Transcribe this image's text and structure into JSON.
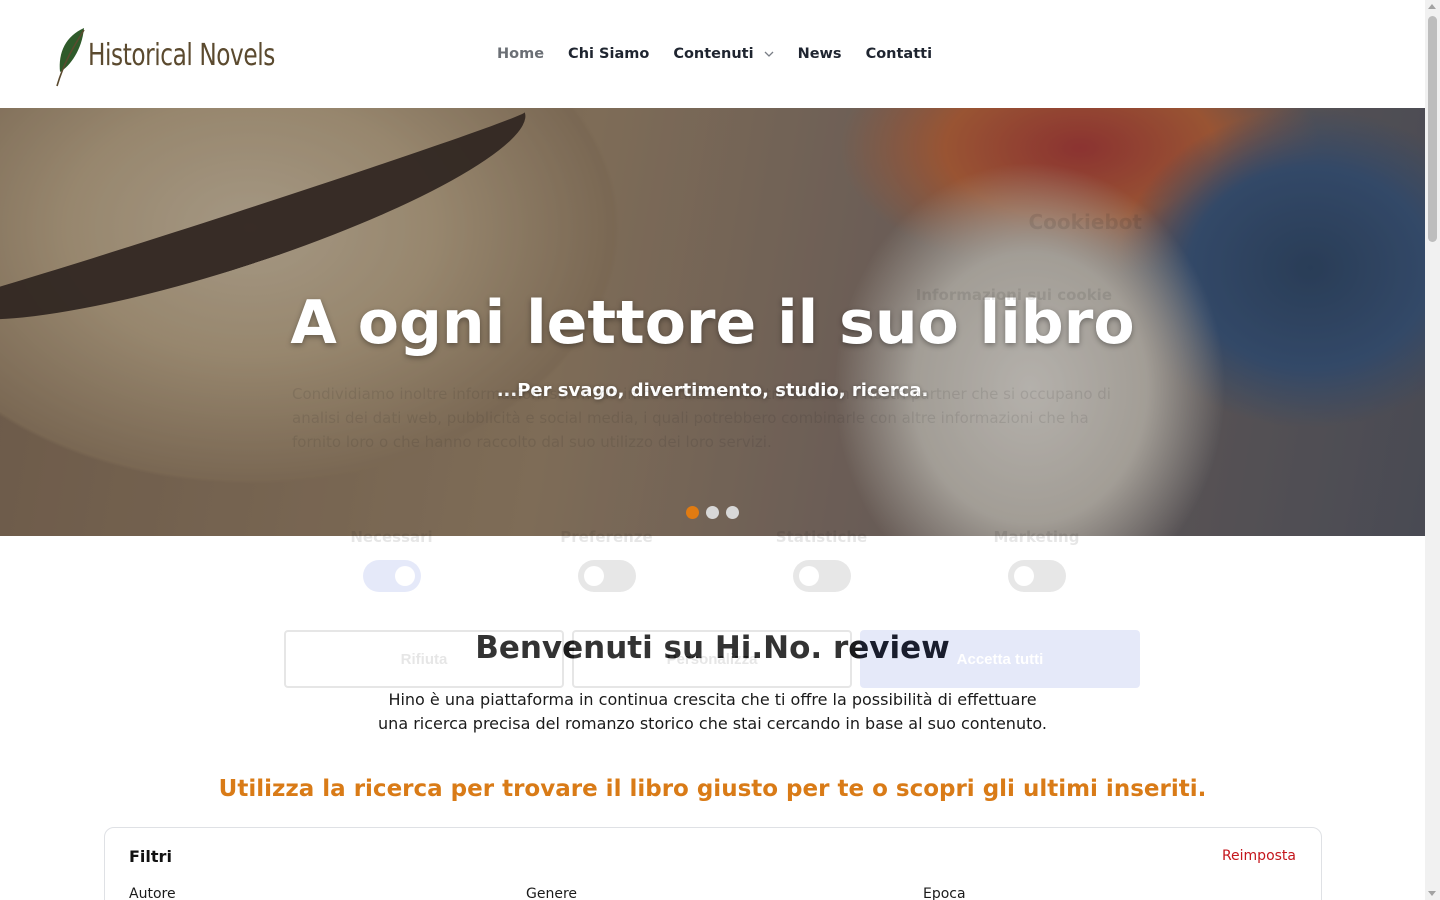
{
  "header": {
    "logo_text": "Historical Novels",
    "nav": [
      {
        "label": "Home",
        "active": true
      },
      {
        "label": "Chi Siamo"
      },
      {
        "label": "Contenuti",
        "has_dropdown": true
      },
      {
        "label": "News"
      },
      {
        "label": "Contatti"
      }
    ]
  },
  "hero": {
    "title": "A ogni lettore il suo libro",
    "subtitle": "...Per svago, divertimento, studio, ricerca.",
    "slide_count": 3,
    "active_slide": 1,
    "active_dot_color": "#e07b12"
  },
  "cookie_banner": {
    "brand": "Cookiebot",
    "title": "Informazioni sui cookie",
    "text": "Condividiamo inoltre informazioni sul modo in cui utilizza il nostro sito con i nostri partner che si occupano di analisi dei dati web, pubblicità e social media, i quali potrebbero combinarle con altre informazioni che ha fornito loro o che hanno raccolto dal suo utilizzo dei loro servizi.",
    "categories": [
      {
        "label": "Necessari",
        "on": true
      },
      {
        "label": "Preferenze",
        "on": false
      },
      {
        "label": "Statistiche",
        "on": false
      },
      {
        "label": "Marketing",
        "on": false
      }
    ],
    "buttons": {
      "reject": "Rifiuta",
      "customize": "Personalizza",
      "accept_all": "Accetta tutti"
    }
  },
  "main": {
    "welcome_title": "Benvenuti su Hi.No. review",
    "intro_line1": "Hino è una piattaforma in continua crescita che ti offre la possibilità di effettuare",
    "intro_line2": "una ricerca precisa del romanzo storico che stai cercando in base al suo contenuto.",
    "callout": "Utilizza la ricerca per trovare il libro giusto per te o scopri gli ultimi inseriti."
  },
  "filters": {
    "title": "Filtri",
    "reset_label": "Reimposta",
    "fields": [
      "Autore",
      "Genere",
      "Epoca"
    ]
  },
  "colors": {
    "accent": "#d97b17",
    "reset": "#c4161c",
    "nav_text": "#1f2530"
  }
}
